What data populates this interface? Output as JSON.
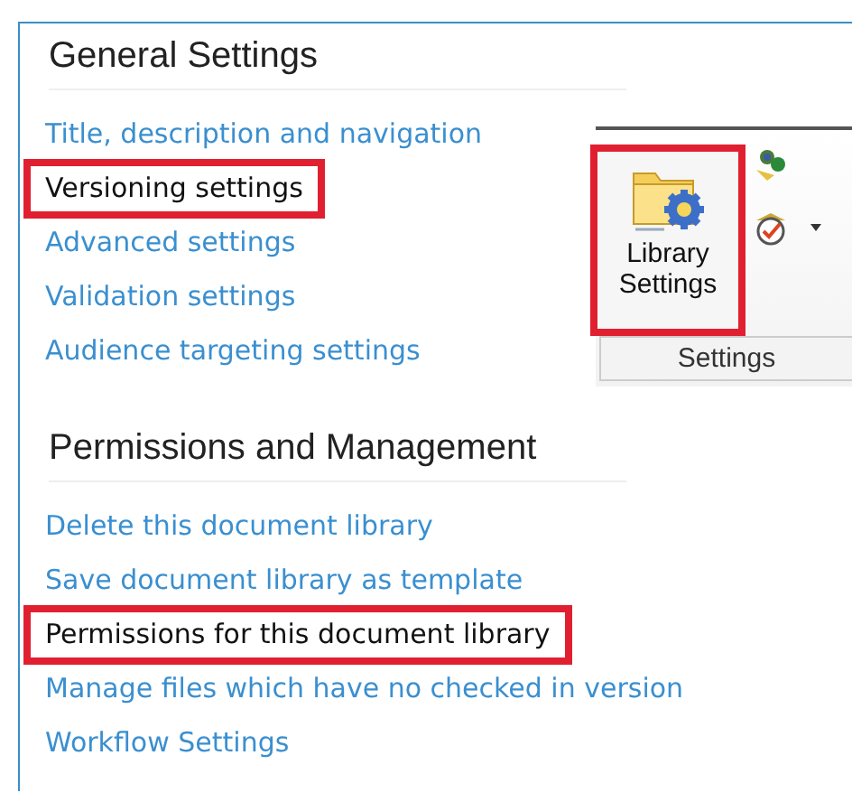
{
  "sections": [
    {
      "heading": "General Settings",
      "links": [
        {
          "label": "Title, description and navigation",
          "highlighted": false
        },
        {
          "label": "Versioning settings",
          "highlighted": true
        },
        {
          "label": "Advanced settings",
          "highlighted": false
        },
        {
          "label": "Validation settings",
          "highlighted": false
        },
        {
          "label": "Audience targeting settings",
          "highlighted": false
        }
      ]
    },
    {
      "heading": "Permissions and Management",
      "links": [
        {
          "label": "Delete this document library",
          "highlighted": false
        },
        {
          "label": "Save document library as template",
          "highlighted": false
        },
        {
          "label": "Permissions for this document library",
          "highlighted": true
        },
        {
          "label": "Manage files which have no checked in version",
          "highlighted": false
        },
        {
          "label": "Workflow Settings",
          "highlighted": false
        }
      ]
    }
  ],
  "ribbon": {
    "button": {
      "label": "Library Settings",
      "highlighted": true
    },
    "group_label": "Settings"
  }
}
